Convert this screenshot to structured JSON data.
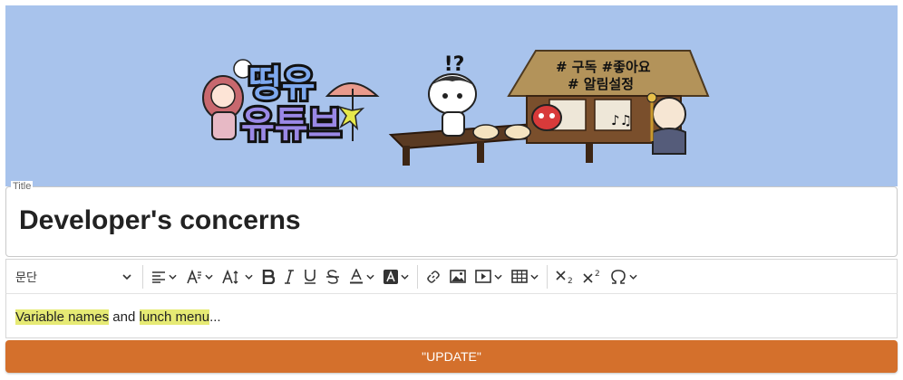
{
  "banner": {
    "logo_line1": "떵유",
    "logo_line2": "유튜브",
    "sign_line1": "# 구독 #좋아요",
    "sign_line2": "# 알림설정",
    "exclaim": "!?",
    "background_color": "#a8c3ec"
  },
  "title": {
    "label": "Title",
    "value": "Developer's concerns"
  },
  "toolbar": {
    "paragraph_label": "문단",
    "buttons": [
      "align-icon",
      "font-size-icon",
      "line-height-icon",
      "bold-icon",
      "italic-icon",
      "underline-icon",
      "strikethrough-icon",
      "font-color-icon",
      "highlight-icon",
      "link-icon",
      "image-icon",
      "media-icon",
      "table-icon",
      "subscript-icon",
      "superscript-icon",
      "special-char-icon"
    ]
  },
  "editor": {
    "highlight1": "Variable names",
    "text1": " and ",
    "highlight2": "lunch menu",
    "text2": "...",
    "highlight_color": "#e6ea74"
  },
  "update_button": {
    "label": "\"UPDATE\"",
    "color": "#d4702c"
  }
}
